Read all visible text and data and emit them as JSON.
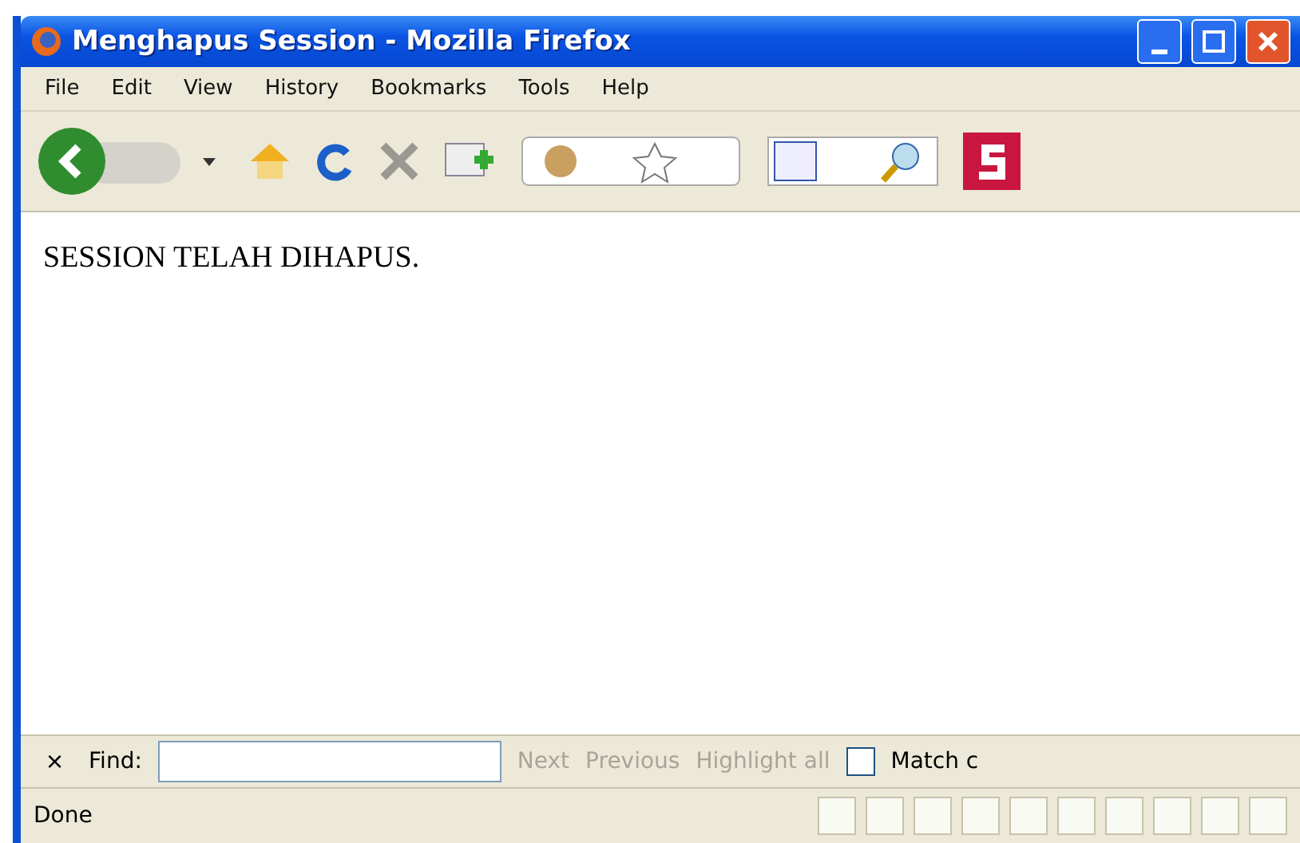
{
  "window": {
    "title": "Menghapus Session - Mozilla Firefox"
  },
  "menu": [
    "File",
    "Edit",
    "View",
    "History",
    "Bookmarks",
    "Tools",
    "Help"
  ],
  "page": {
    "text": "SESSION TELAH DIHAPUS."
  },
  "find_bar": {
    "close": "×",
    "label": "Find:",
    "next": "Next",
    "previous": "Previous",
    "highlight": "Highlight all",
    "match_case": {
      "label": "Match c",
      "checked": false
    }
  },
  "status_bar": {
    "text": "Done"
  }
}
